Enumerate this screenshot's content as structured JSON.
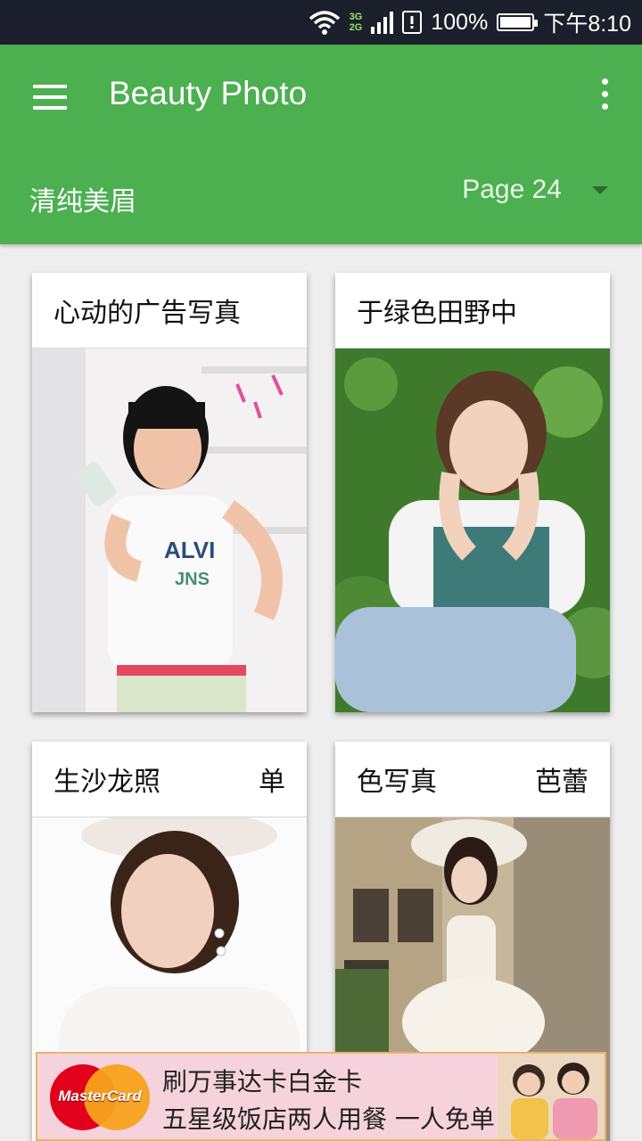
{
  "status_bar": {
    "network_top": "3G",
    "network_bottom": "2G",
    "battery": "100%",
    "time": "下午8:10"
  },
  "app_bar": {
    "title": "Beauty Photo",
    "menu_icon": "hamburger-menu-icon",
    "more_icon": "more-vert-icon",
    "category": "清纯美眉",
    "page": "Page 24",
    "accent": "#4caf50"
  },
  "cards": [
    {
      "title": "心动的广告写真",
      "extra": ""
    },
    {
      "title": "于绿色田野中",
      "extra": ""
    },
    {
      "title": "生沙龙照",
      "extra": "单"
    },
    {
      "title": "色写真",
      "extra": "芭蕾"
    }
  ],
  "ad": {
    "brand": "MasterCard",
    "line1": "刷万事达卡白金卡",
    "line2": "五星级饭店两人用餐 一人免单"
  }
}
